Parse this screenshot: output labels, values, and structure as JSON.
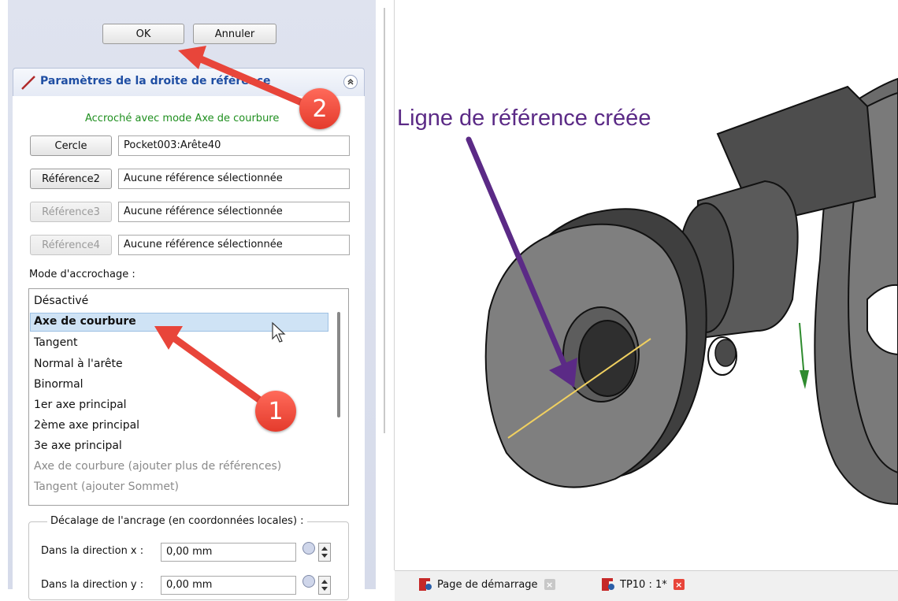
{
  "dialog": {
    "ok_label": "OK",
    "cancel_label": "Annuler"
  },
  "taskbox": {
    "title": "Paramètres de la droite de référence",
    "status": "Accroché avec mode Axe de courbure",
    "references": [
      {
        "button": "Cercle",
        "value": "Pocket003:Arête40",
        "enabled": true
      },
      {
        "button": "Référence2",
        "value": "Aucune référence sélectionnée",
        "enabled": true
      },
      {
        "button": "Référence3",
        "value": "Aucune référence sélectionnée",
        "enabled": false
      },
      {
        "button": "Référence4",
        "value": "Aucune référence sélectionnée",
        "enabled": false
      }
    ],
    "mode_label": "Mode d'accrochage :",
    "modes": [
      {
        "label": "Désactivé",
        "state": "normal"
      },
      {
        "label": "Axe de courbure",
        "state": "selected"
      },
      {
        "label": "Tangent",
        "state": "normal"
      },
      {
        "label": "Normal à l'arête",
        "state": "normal"
      },
      {
        "label": "Binormal",
        "state": "normal"
      },
      {
        "label": "1er axe principal",
        "state": "normal"
      },
      {
        "label": "2ème axe principal",
        "state": "normal"
      },
      {
        "label": "3e axe principal",
        "state": "normal"
      },
      {
        "label": "Axe de courbure (ajouter plus de références)",
        "state": "disabled"
      },
      {
        "label": "Tangent (ajouter Sommet)",
        "state": "disabled"
      }
    ],
    "offset_group_title": "Décalage de l'ancrage (en coordonnées locales) :",
    "offset_x_label": "Dans la direction x :",
    "offset_x_value": "0,00 mm",
    "offset_y_label": "Dans la direction y :",
    "offset_y_value": "0,00 mm"
  },
  "annotations": {
    "step1": "1",
    "step2": "2",
    "viewport_caption": "Ligne de référence créée"
  },
  "tabs": [
    {
      "label": "Page de démarrage",
      "active": false
    },
    {
      "label": "TP10 : 1*",
      "active": true
    }
  ],
  "colors": {
    "status_green": "#1f8f1f",
    "title_blue": "#1f4ea3",
    "annotation_red": "#e8453a",
    "annotation_purple": "#5b2a86",
    "reference_line": "#f0d060"
  }
}
